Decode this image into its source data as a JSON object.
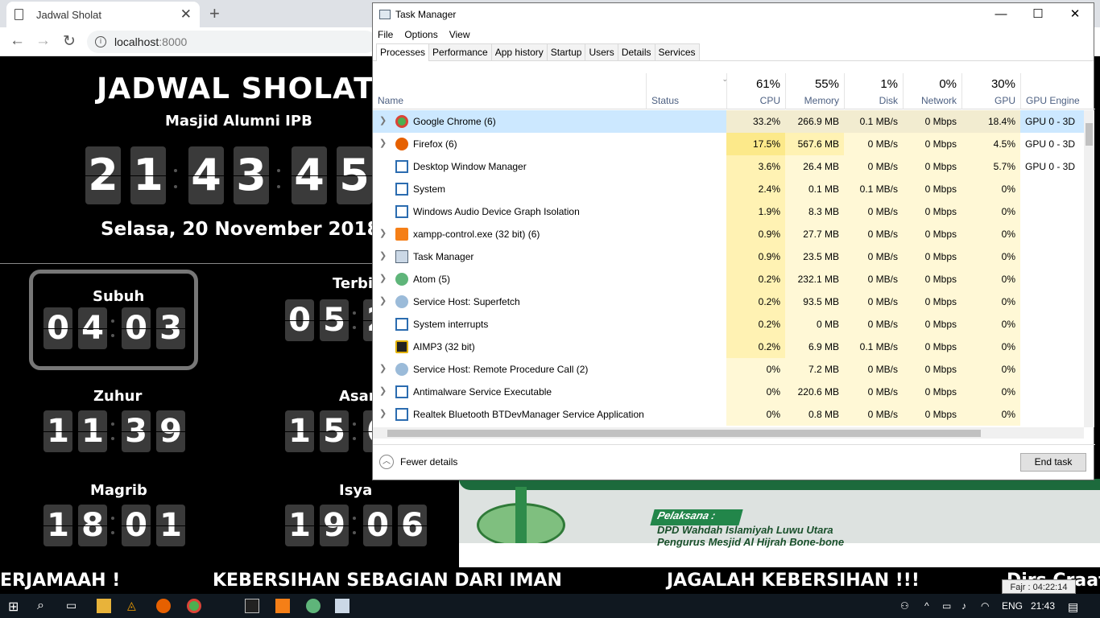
{
  "browser": {
    "tab_title": "Jadwal Sholat",
    "url_host": "localhost",
    "url_port": ":8000"
  },
  "page": {
    "title": "JADWAL SHOLAT",
    "subtitle": "Masjid Alumni IPB",
    "clock": [
      "2",
      "1",
      "4",
      "3",
      "4",
      "5"
    ],
    "date": "Selasa, 20 November 2018",
    "prayers": [
      {
        "name": "Subuh",
        "digits": [
          "0",
          "4",
          "0",
          "3"
        ]
      },
      {
        "name": "Terbi",
        "digits": [
          "0",
          "5",
          "2"
        ]
      },
      {
        "name": "Zuhur",
        "digits": [
          "1",
          "1",
          "3",
          "9"
        ]
      },
      {
        "name": "Asar",
        "digits": [
          "1",
          "5",
          "6"
        ]
      },
      {
        "name": "Magrib",
        "digits": [
          "1",
          "8",
          "0",
          "1"
        ]
      },
      {
        "name": "Isya",
        "digits": [
          "1",
          "9",
          "0",
          "6"
        ]
      }
    ],
    "banner": {
      "label": "Pelaksana :",
      "line1": "DPD Wahdah Islamiyah Luwu Utara",
      "line2": "Pengurus Mesjid Al Hijrah Bone-bone"
    },
    "ticker": [
      "ERJAMAAH !",
      "KEBERSIHAN SEBAGIAN DARI IMAN",
      "JAGALAH KEBERSIHAN !!!",
      "Dirs Craat"
    ],
    "fajr": "Fajr : 04:22:14"
  },
  "tm": {
    "title": "Task Manager",
    "menu": [
      "File",
      "Options",
      "View"
    ],
    "tabs": [
      "Processes",
      "Performance",
      "App history",
      "Startup",
      "Users",
      "Details",
      "Services"
    ],
    "cols": {
      "name": "Name",
      "status": "Status",
      "cpu_pct": "61%",
      "cpu": "CPU",
      "mem_pct": "55%",
      "mem": "Memory",
      "disk_pct": "1%",
      "disk": "Disk",
      "net_pct": "0%",
      "net": "Network",
      "gpu_pct": "30%",
      "gpu": "GPU",
      "eng": "GPU Engine"
    },
    "rows": [
      {
        "name": "Google Chrome (6)",
        "cpu": "33.2%",
        "mem": "266.9 MB",
        "disk": "0.1 MB/s",
        "net": "0 Mbps",
        "gpu": "18.4%",
        "eng": "GPU 0 - 3D",
        "exp": true,
        "icon": "chrome-icon"
      },
      {
        "name": "Firefox (6)",
        "cpu": "17.5%",
        "mem": "567.6 MB",
        "disk": "0 MB/s",
        "net": "0 Mbps",
        "gpu": "4.5%",
        "eng": "GPU 0 - 3D",
        "exp": true,
        "icon": "firefox-icon"
      },
      {
        "name": "Desktop Window Manager",
        "cpu": "3.6%",
        "mem": "26.4 MB",
        "disk": "0 MB/s",
        "net": "0 Mbps",
        "gpu": "5.7%",
        "eng": "GPU 0 - 3D",
        "exp": false,
        "icon": "window-icon"
      },
      {
        "name": "System",
        "cpu": "2.4%",
        "mem": "0.1 MB",
        "disk": "0.1 MB/s",
        "net": "0 Mbps",
        "gpu": "0%",
        "eng": "",
        "exp": false,
        "icon": "window-icon"
      },
      {
        "name": "Windows Audio Device Graph Isolation",
        "cpu": "1.9%",
        "mem": "8.3 MB",
        "disk": "0 MB/s",
        "net": "0 Mbps",
        "gpu": "0%",
        "eng": "",
        "exp": false,
        "icon": "window-icon"
      },
      {
        "name": "xampp-control.exe (32 bit) (6)",
        "cpu": "0.9%",
        "mem": "27.7 MB",
        "disk": "0 MB/s",
        "net": "0 Mbps",
        "gpu": "0%",
        "eng": "",
        "exp": true,
        "icon": "xampp-icon"
      },
      {
        "name": "Task Manager",
        "cpu": "0.9%",
        "mem": "23.5 MB",
        "disk": "0 MB/s",
        "net": "0 Mbps",
        "gpu": "0%",
        "eng": "",
        "exp": true,
        "icon": "taskmgr-icon"
      },
      {
        "name": "Atom (5)",
        "cpu": "0.2%",
        "mem": "232.1 MB",
        "disk": "0 MB/s",
        "net": "0 Mbps",
        "gpu": "0%",
        "eng": "",
        "exp": true,
        "icon": "atom-icon"
      },
      {
        "name": "Service Host: Superfetch",
        "cpu": "0.2%",
        "mem": "93.5 MB",
        "disk": "0 MB/s",
        "net": "0 Mbps",
        "gpu": "0%",
        "eng": "",
        "exp": true,
        "icon": "gear-icon"
      },
      {
        "name": "System interrupts",
        "cpu": "0.2%",
        "mem": "0 MB",
        "disk": "0 MB/s",
        "net": "0 Mbps",
        "gpu": "0%",
        "eng": "",
        "exp": false,
        "icon": "window-icon"
      },
      {
        "name": "AIMP3 (32 bit)",
        "cpu": "0.2%",
        "mem": "6.9 MB",
        "disk": "0.1 MB/s",
        "net": "0 Mbps",
        "gpu": "0%",
        "eng": "",
        "exp": false,
        "icon": "aimp-icon"
      },
      {
        "name": "Service Host: Remote Procedure Call (2)",
        "cpu": "0%",
        "mem": "7.2 MB",
        "disk": "0 MB/s",
        "net": "0 Mbps",
        "gpu": "0%",
        "eng": "",
        "exp": true,
        "icon": "gear-icon"
      },
      {
        "name": "Antimalware Service Executable",
        "cpu": "0%",
        "mem": "220.6 MB",
        "disk": "0 MB/s",
        "net": "0 Mbps",
        "gpu": "0%",
        "eng": "",
        "exp": true,
        "icon": "window-icon"
      },
      {
        "name": "Realtek Bluetooth BTDevManager Service Application",
        "cpu": "0%",
        "mem": "0.8 MB",
        "disk": "0 MB/s",
        "net": "0 Mbps",
        "gpu": "0%",
        "eng": "",
        "exp": true,
        "icon": "window-icon"
      }
    ],
    "fewer": "Fewer details",
    "end_task": "End task"
  },
  "taskbar": {
    "lang": "ENG",
    "time": "21:43"
  },
  "colors": {
    "cpu_heat": "#fff2b3",
    "cpu_heat2": "#fce98a",
    "cell": "#fff8d6",
    "selected": "#cce8ff"
  }
}
